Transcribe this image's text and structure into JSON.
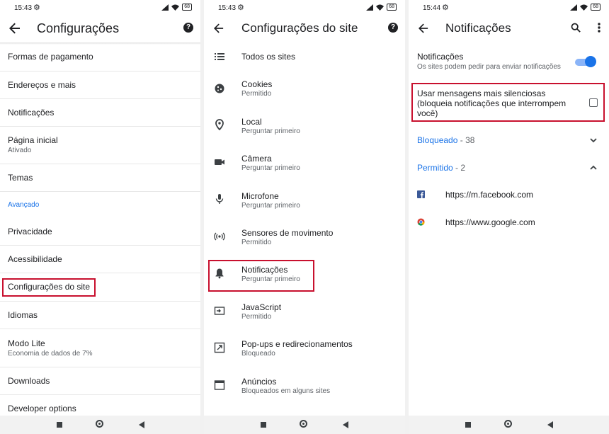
{
  "status": {
    "p1_time": "15:43",
    "p2_time": "15:43",
    "p3_time": "15:44",
    "battery": "68"
  },
  "panel1": {
    "title": "Configurações",
    "items": [
      {
        "label": "Formas de pagamento"
      },
      {
        "label": "Endereços e mais"
      },
      {
        "label": "Notificações"
      },
      {
        "label": "Página inicial",
        "sub": "Ativado"
      },
      {
        "label": "Temas"
      },
      {
        "label": "Privacidade"
      },
      {
        "label": "Acessibilidade"
      },
      {
        "label": "Configurações do site"
      },
      {
        "label": "Idiomas"
      },
      {
        "label": "Modo Lite",
        "sub": "Economia de dados de 7%"
      },
      {
        "label": "Downloads"
      },
      {
        "label": "Developer options"
      }
    ],
    "section_advanced": "Avançado"
  },
  "panel2": {
    "title": "Configurações do site",
    "items": [
      {
        "label": "Todos os sites",
        "icon": "list-icon"
      },
      {
        "label": "Cookies",
        "sub": "Permitido",
        "icon": "cookie-icon"
      },
      {
        "label": "Local",
        "sub": "Perguntar primeiro",
        "icon": "location-pin-icon"
      },
      {
        "label": "Câmera",
        "sub": "Perguntar primeiro",
        "icon": "camera-icon"
      },
      {
        "label": "Microfone",
        "sub": "Perguntar primeiro",
        "icon": "microphone-icon"
      },
      {
        "label": "Sensores de movimento",
        "sub": "Permitido",
        "icon": "motion-sensor-icon"
      },
      {
        "label": "Notificações",
        "sub": "Perguntar primeiro",
        "icon": "bell-icon"
      },
      {
        "label": "JavaScript",
        "sub": "Permitido",
        "icon": "javascript-icon"
      },
      {
        "label": "Pop-ups e redirecionamentos",
        "sub": "Bloqueado",
        "icon": "popup-icon"
      },
      {
        "label": "Anúncios",
        "sub": "Bloqueados em alguns sites",
        "icon": "ads-icon"
      }
    ]
  },
  "panel3": {
    "title": "Notificações",
    "toggle_label": "Notificações",
    "toggle_sub": "Os sites podem pedir para enviar notificações",
    "toggle_on": true,
    "quiet_line1": "Usar mensagens mais silenciosas",
    "quiet_line2": "(bloqueia notificações que interrompem",
    "quiet_line3": "você)",
    "quiet_checked": false,
    "blocked_label": "Bloqueado",
    "blocked_count": "- 38",
    "allowed_label": "Permitido",
    "allowed_count": "- 2",
    "sites": [
      {
        "url": "https://m.facebook.com",
        "icon": "facebook-icon"
      },
      {
        "url": "https://www.google.com",
        "icon": "chrome-icon"
      }
    ]
  },
  "colors": {
    "accent": "#1a73e8",
    "highlight": "#c8102e"
  }
}
